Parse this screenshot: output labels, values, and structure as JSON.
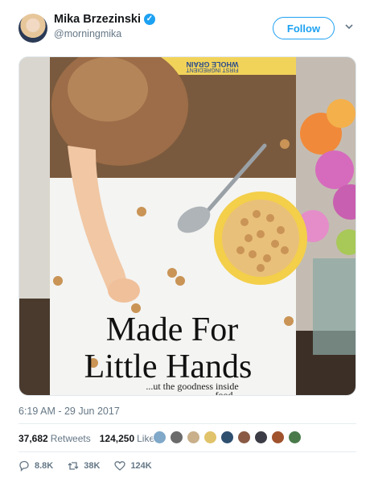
{
  "author": {
    "name": "Mika Brzezinski",
    "handle": "@morningmika",
    "verified_glyph": "✓"
  },
  "follow_label": "Follow",
  "media": {
    "cereal_box_headline_line1": "Made For",
    "cereal_box_headline_line2": "Little Hands",
    "cereal_box_subtext_line1": "...ut the goodness inside",
    "cereal_box_subtext_line2": "...food",
    "cereal_box_top_line1": "WHOLE GRAIN",
    "cereal_box_top_line2": "FIRST INGREDIENT"
  },
  "timestamp": "6:19 AM - 29 Jun 2017",
  "stats": {
    "retweets_count": "37,682",
    "retweets_label": "Retweets",
    "likes_count": "124,250",
    "likes_label": "Likes"
  },
  "likers": [
    {
      "color": "#7fa8c9"
    },
    {
      "color": "#6b6b6b"
    },
    {
      "color": "#c9b08a"
    },
    {
      "color": "#e0c36a"
    },
    {
      "color": "#2f4f6f"
    },
    {
      "color": "#8a5a44"
    },
    {
      "color": "#3c3c46"
    },
    {
      "color": "#a0522d"
    },
    {
      "color": "#4a7a4a"
    }
  ],
  "actions": {
    "replies": "8.8K",
    "retweets": "38K",
    "likes": "124K"
  },
  "colors": {
    "accent": "#1da1f2",
    "muted_text": "#657786"
  }
}
